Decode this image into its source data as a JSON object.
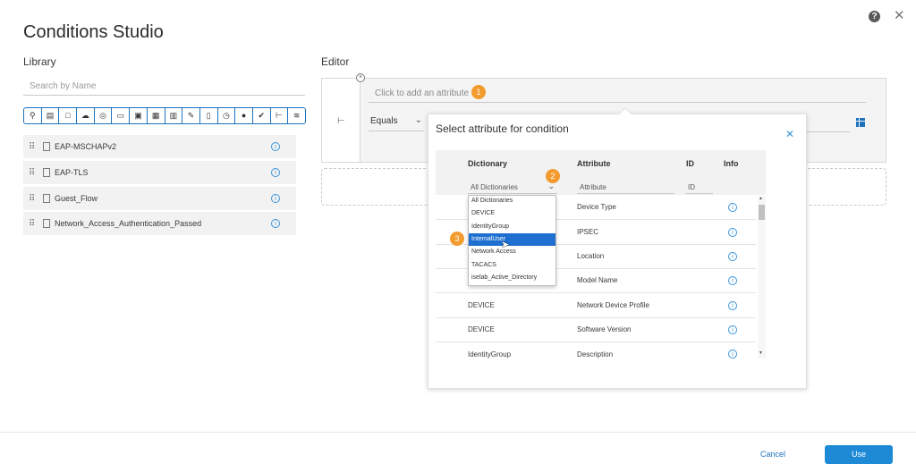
{
  "header": {
    "title": "Conditions Studio",
    "help_icon": "help-icon",
    "close_icon": "close-icon"
  },
  "library": {
    "label": "Library",
    "search_placeholder": "Search by Name",
    "filter_icons": [
      "location-pin-icon",
      "id-card-icon",
      "square-icon",
      "cloud-icon",
      "globe-icon",
      "monitor-icon",
      "desktop-icon",
      "certificate-icon",
      "id-badge-icon",
      "edit-icon",
      "server-icon",
      "clock-icon",
      "user-icon",
      "check-circle-icon",
      "tree-icon",
      "wifi-icon"
    ],
    "items": [
      {
        "label": "EAP-MSCHAPv2"
      },
      {
        "label": "EAP-TLS"
      },
      {
        "label": "Guest_Flow"
      },
      {
        "label": "Network_Access_Authentication_Passed"
      }
    ]
  },
  "editor": {
    "label": "Editor",
    "attribute_placeholder": "Click to add an attribute",
    "operator": "Equals",
    "badge_1": "1"
  },
  "popup": {
    "title": "Select attribute for condition",
    "columns": {
      "dictionary": "Dictionary",
      "attribute": "Attribute",
      "id": "ID",
      "info": "Info"
    },
    "filters": {
      "dictionary": "All Dictionaries",
      "attribute": "Attribute",
      "id": "ID"
    },
    "badge_2": "2",
    "badge_3": "3",
    "rows": [
      {
        "dictionary": "",
        "attribute": "Device Type"
      },
      {
        "dictionary": "",
        "attribute": "IPSEC"
      },
      {
        "dictionary": "",
        "attribute": "Location"
      },
      {
        "dictionary": "",
        "attribute": "Model Name"
      },
      {
        "dictionary": "DEVICE",
        "attribute": "Network Device Profile"
      },
      {
        "dictionary": "DEVICE",
        "attribute": "Software Version"
      },
      {
        "dictionary": "IdentityGroup",
        "attribute": "Description"
      }
    ],
    "dropdown_options": [
      "All Dictionaries",
      "DEVICE",
      "IdentityGroup",
      "InternalUser",
      "Network Access",
      "TACACS",
      "iselab_Active_Directory"
    ],
    "dropdown_selected": "InternalUser"
  },
  "footer": {
    "cancel_label": "Cancel",
    "use_label": "Use"
  },
  "colors": {
    "accent": "#1e8ad6",
    "badge": "#f39b2e",
    "selected": "#1e6fd0"
  }
}
